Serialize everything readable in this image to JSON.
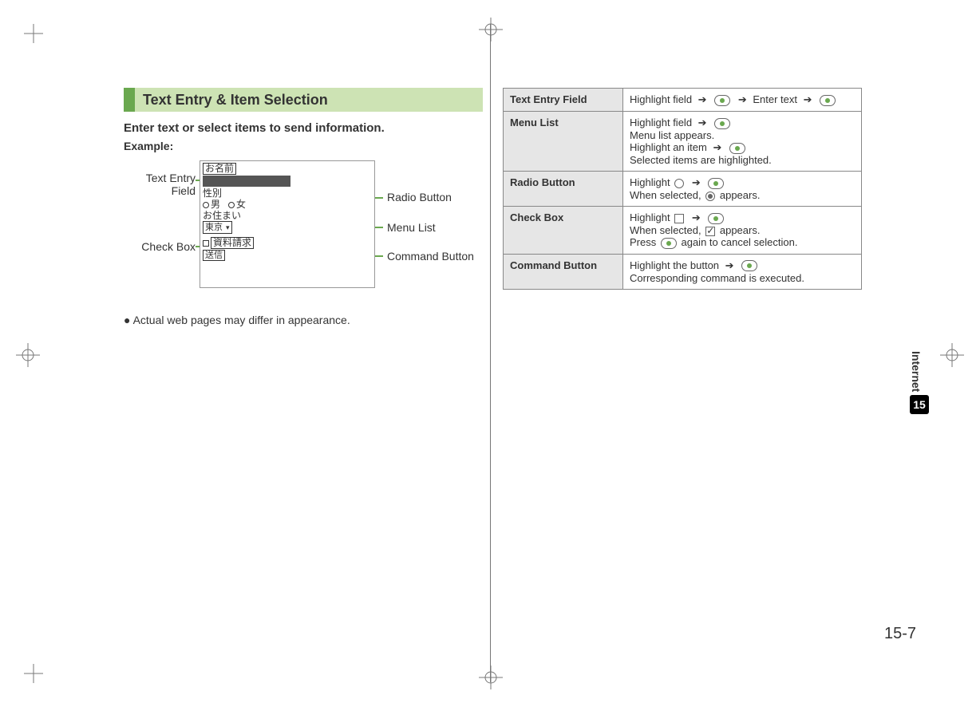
{
  "header": {
    "section_title": "Text Entry & Item Selection",
    "intro_bold": "Enter text or select items to send information.",
    "example_label": "Example:"
  },
  "screen": {
    "name_label": "お名前",
    "gender_label": "性別",
    "gender_male": "男",
    "gender_female": "女",
    "address_label": "お住まい",
    "address_value": "東京",
    "request_label": "資料請求",
    "send_label": "送信"
  },
  "callouts": {
    "text_entry_field": "Text Entry\nField",
    "check_box": "Check Box",
    "radio_button": "Radio Button",
    "menu_list": "Menu List",
    "command_button": "Command Button"
  },
  "note": "Actual web pages may differ in appearance.",
  "table": {
    "rows": [
      {
        "label": "Text Entry Field",
        "text_before_key1": "Highlight field",
        "mid_text": "Enter text"
      },
      {
        "label": "Menu List",
        "line1": "Highlight field",
        "line2": "Menu list appears.",
        "line3": "Highlight an item",
        "line4": "Selected items are highlighted."
      },
      {
        "label": "Radio Button",
        "line1a": "Highlight",
        "line2a": "When selected,",
        "line2b": "appears."
      },
      {
        "label": "Check Box",
        "line1a": "Highlight",
        "line2a": "When selected,",
        "line2b": "appears.",
        "line3a": "Press",
        "line3b": "again to cancel selection."
      },
      {
        "label": "Command Button",
        "line1": "Highlight the button",
        "line2": "Corresponding command is executed."
      }
    ]
  },
  "sidebar": {
    "label": "Internet",
    "chapter": "15"
  },
  "page_number": "15-7"
}
